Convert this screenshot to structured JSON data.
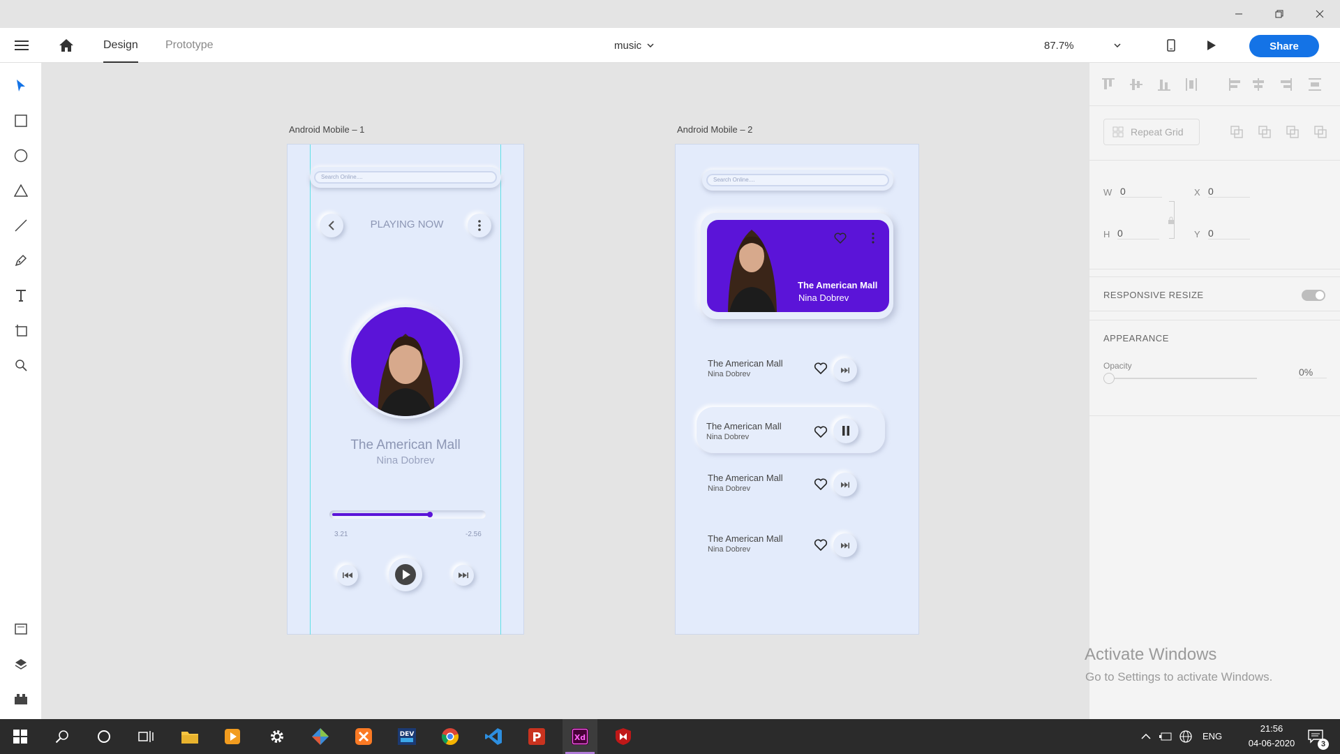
{
  "app": {
    "tabs": [
      {
        "label": "Design"
      },
      {
        "label": "Prototype"
      }
    ],
    "document_name": "music",
    "zoom": "87.7%",
    "share_label": "Share"
  },
  "artboards": [
    {
      "label": "Android Mobile – 1",
      "search_placeholder": "Search Online....",
      "header_title": "PLAYING NOW",
      "song_title": "The American Mall",
      "artist": "Nina Dobrev",
      "progress": 0.65,
      "time_elapsed": "3.21",
      "time_remaining": "-2.56"
    },
    {
      "label": "Android Mobile – 2",
      "search_placeholder": "Search Online....",
      "featured": {
        "title": "The American Mall",
        "artist": "Nina Dobrev"
      },
      "songs": [
        {
          "title": "The American Mall",
          "artist": "Nina Dobrev",
          "control": "next"
        },
        {
          "title": "The American Mall",
          "artist": "Nina Dobrev",
          "control": "pause"
        },
        {
          "title": "The American Mall",
          "artist": "Nina Dobrev",
          "control": "next"
        },
        {
          "title": "The American Mall",
          "artist": "Nina Dobrev",
          "control": "next"
        }
      ]
    }
  ],
  "right_panel": {
    "repeat_grid": "Repeat Grid",
    "w_label": "W",
    "w_value": "0",
    "h_label": "H",
    "h_value": "0",
    "x_label": "X",
    "x_value": "0",
    "y_label": "Y",
    "y_value": "0",
    "responsive_resize": "RESPONSIVE RESIZE",
    "appearance": "APPEARANCE",
    "opacity_label": "Opacity",
    "opacity_value": "0%"
  },
  "watermark": {
    "title": "Activate Windows",
    "subtitle": "Go to Settings to activate Windows."
  },
  "taskbar": {
    "language": "ENG",
    "time": "21:56",
    "date": "04-06-2020",
    "notification_count": "3"
  },
  "colors": {
    "accent_purple": "#5b14d8",
    "share_blue": "#1473e6",
    "artboard_bg": "#e3ebfb"
  }
}
